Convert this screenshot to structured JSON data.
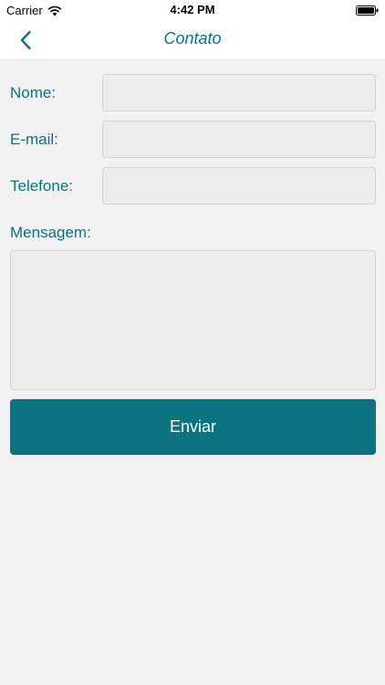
{
  "status_bar": {
    "carrier": "Carrier",
    "time": "4:42 PM",
    "wifi_icon": "wifi-icon",
    "battery_icon": "battery-icon"
  },
  "nav": {
    "title": "Contato",
    "back_icon": "chevron-left-icon"
  },
  "form": {
    "name_label": "Nome:",
    "name_value": "",
    "email_label": "E-mail:",
    "email_value": "",
    "phone_label": "Telefone:",
    "phone_value": "",
    "message_label": "Mensagem:",
    "message_value": "",
    "submit_label": "Enviar"
  },
  "colors": {
    "accent": "#0b7480",
    "background": "#f1f1f1",
    "field_background": "#ececec"
  }
}
